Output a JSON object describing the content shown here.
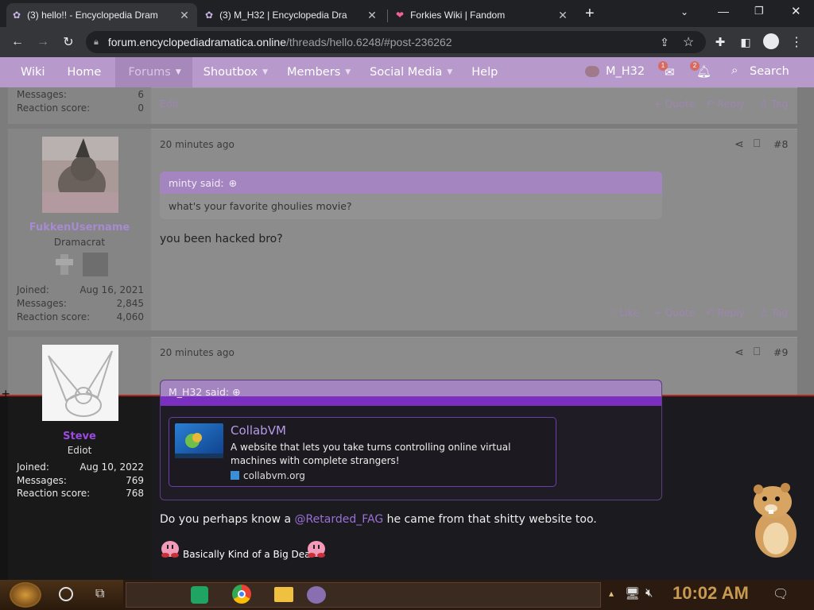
{
  "browser": {
    "tabs": [
      {
        "title": "(3) hello!! - Encyclopedia Dram",
        "active": true
      },
      {
        "title": "(3) M_H32 | Encyclopedia Dra",
        "active": false
      },
      {
        "title": "Forkies Wiki | Fandom",
        "active": false
      }
    ],
    "url_host": "forum.encyclopediadramatica.online",
    "url_path": "/threads/hello.6248/#post-236262"
  },
  "nav": {
    "items": [
      "Wiki",
      "Home",
      "Forums",
      "Shoutbox",
      "Members",
      "Social Media",
      "Help"
    ],
    "user": "M_H32",
    "inbox_count": "1",
    "alerts_count": "2",
    "search": "Search"
  },
  "prev_post": {
    "messages_label": "Messages:",
    "messages": "6",
    "reaction_label": "Reaction score:",
    "reaction": "0",
    "edit": "Edit",
    "quote": "+ Quote",
    "reply": "Reply",
    "tag": "Tag"
  },
  "post8": {
    "username": "FukkenUsername",
    "title": "Dramacrat",
    "joined_label": "Joined:",
    "joined": "Aug 16, 2021",
    "messages_label": "Messages:",
    "messages": "2,845",
    "reaction_label": "Reaction score:",
    "reaction": "4,060",
    "time": "20 minutes ago",
    "number": "#8",
    "quote_author": "minty said:",
    "quote_text": "what's your favorite ghoulies movie?",
    "body": "you been hacked bro?",
    "like": "Like",
    "quote": "+ Quote",
    "reply": "Reply",
    "tag": "Tag"
  },
  "post9": {
    "username": "Steve",
    "title": "Ediot",
    "joined_label": "Joined:",
    "joined": "Aug 10, 2022",
    "messages_label": "Messages:",
    "messages": "769",
    "reaction_label": "Reaction score:",
    "reaction": "768",
    "time": "20 minutes ago",
    "number": "#9",
    "quote_author": "M_H32 said:",
    "embed_title": "CollabVM",
    "embed_desc": "A website that lets you take turns controlling online virtual machines with complete strangers!",
    "embed_domain": "collabvm.org",
    "body_before": "Do you perhaps know a ",
    "mention": "@Retarded_FAG",
    "body_after": " he came from that shitty website too.",
    "signature": "Basically Kind of a Big Deal"
  },
  "taskbar": {
    "clock": "10:02 AM"
  },
  "colors": {
    "accent": "#b79acb",
    "username_dim": "#a78bd0",
    "username_steve": "#9a4be0",
    "mention": "#9b6fd6"
  }
}
